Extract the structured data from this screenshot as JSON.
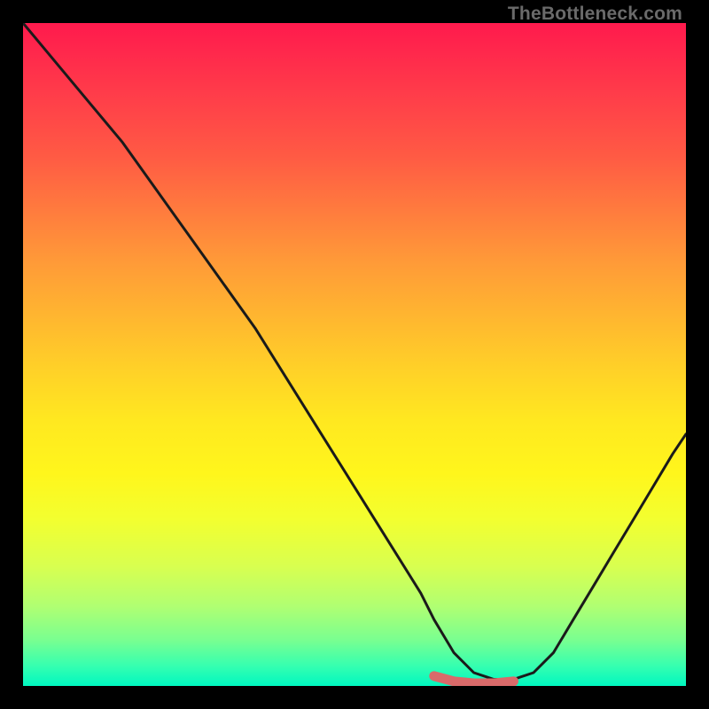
{
  "watermark": {
    "text": "TheBottleneck.com"
  },
  "colors": {
    "frame": "#000000",
    "curve_stroke": "#1a1a1a",
    "accent_stroke": "#d96a6a"
  },
  "chart_data": {
    "type": "line",
    "title": "",
    "xlabel": "",
    "ylabel": "",
    "xlim": [
      0,
      100
    ],
    "ylim": [
      0,
      100
    ],
    "grid": false,
    "series": [
      {
        "name": "bottleneck-curve",
        "x": [
          0,
          5,
          10,
          15,
          20,
          25,
          30,
          35,
          40,
          45,
          50,
          55,
          60,
          62,
          65,
          68,
          71,
          74,
          77,
          80,
          83,
          86,
          89,
          92,
          95,
          98,
          100
        ],
        "values": [
          100,
          94,
          88,
          82,
          75,
          68,
          61,
          54,
          46,
          38,
          30,
          22,
          14,
          10,
          5,
          2,
          1,
          1,
          2,
          5,
          10,
          15,
          20,
          25,
          30,
          35,
          38
        ]
      }
    ],
    "accent_segment": {
      "name": "optimal-zone",
      "x": [
        62,
        65,
        68,
        71,
        74
      ],
      "values": [
        1.5,
        0.7,
        0.4,
        0.4,
        0.7
      ]
    }
  }
}
